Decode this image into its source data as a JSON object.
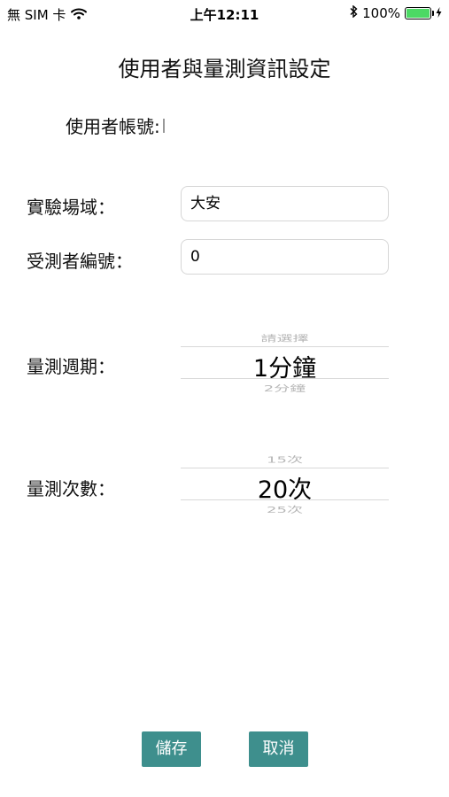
{
  "status_bar": {
    "carrier": "無 SIM 卡",
    "time": "上午12:11",
    "battery": "100%",
    "battery_level": 1.0
  },
  "page_title": "使用者與量測資訊設定",
  "account": {
    "label": "使用者帳號:",
    "value": ""
  },
  "site": {
    "label": "實驗場域：",
    "value": "大安"
  },
  "subject": {
    "label": "受測者編號：",
    "value": "0"
  },
  "period": {
    "label": "量測週期：",
    "options_above": "請選擇",
    "selected": "1分鐘",
    "options_below": "2分鐘"
  },
  "count": {
    "label": "量測次數：",
    "options_above": "15次",
    "selected": "20次",
    "options_below": "25次"
  },
  "buttons": {
    "save": "儲存",
    "cancel": "取消"
  },
  "colors": {
    "button_bg": "#3e8f8d",
    "battery": "#4cd964"
  },
  "icons": [
    "wifi-icon",
    "bluetooth-icon",
    "battery-icon",
    "charging-icon"
  ]
}
